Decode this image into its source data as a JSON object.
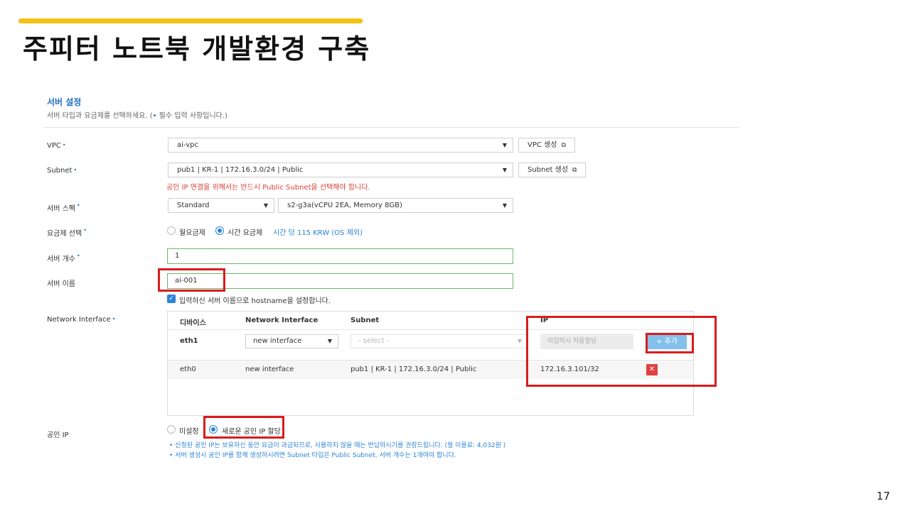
{
  "slide": {
    "title": "주피터 노트북 개발환경 구축",
    "page_number": "17",
    "accent_color": "#f6c112"
  },
  "section": {
    "title": "서버 설정",
    "desc_before": "서버 타입과 요금제를 선택하세요. (",
    "desc_marker": "•",
    "desc_after": " 필수 입력 사항입니다.)"
  },
  "required_marker": "•",
  "vpc": {
    "label": "VPC",
    "value": "ai-vpc",
    "create_button": "VPC 생성"
  },
  "subnet": {
    "label": "Subnet",
    "value": "pub1 | KR-1 | 172.16.3.0/24 | Public",
    "create_button": "Subnet 생성",
    "warning": "공인 IP 연결을 위해서는 반드시 Public Subnet을 선택해야 합니다."
  },
  "server_spec": {
    "label": "서버 스펙",
    "type": "Standard",
    "spec": "s2-g3a(vCPU 2EA, Memory 8GB)"
  },
  "pricing": {
    "label": "요금제 선택",
    "monthly": "월요금제",
    "hourly": "시간 요금제",
    "selected": "hourly",
    "price_text": "시간 당 115 KRW (OS 제외)"
  },
  "server_count": {
    "label": "서버 개수",
    "value": "1"
  },
  "server_name": {
    "label": "서버 이름",
    "value": "ai-001",
    "hostname_checkbox": "입력하신 서버 이름으로 hostname을 설정합니다.",
    "hostname_checked": true
  },
  "network_interface": {
    "label": "Network Interface",
    "columns": [
      "디바이스",
      "Network Interface",
      "Subnet",
      "IP"
    ],
    "new_row": {
      "device": "eth1",
      "interface": "new interface",
      "subnet_placeholder": "- select -",
      "ip_placeholder": "미입력시 자동할당",
      "add_button": "+ 추가"
    },
    "rows": [
      {
        "device": "eth0",
        "interface": "new interface",
        "subnet": "pub1 | KR-1 | 172.16.3.0/24 | Public",
        "ip": "172.16.3.101/32",
        "delete": "✕"
      }
    ]
  },
  "public_ip": {
    "label": "공인 IP",
    "option_none": "미설정",
    "option_new": "새로운 공인 IP 할당",
    "selected": "new",
    "notes": [
      "신청된 공인 IP는 보유하신 동안 요금이 과금되므로, 사용하지 않을 때는 반납하시기를 권장드립니다. (월 이용료: 4,032원 )",
      "서버 생성시 공인 IP를 함께 생성하시려면 Subnet 타입은 Public Subnet, 서버 개수는 1개여야 합니다."
    ]
  },
  "colors": {
    "accent_blue": "#2b84d6",
    "warning_red": "#d9423a",
    "highlight_red": "#d91c1c",
    "input_green": "#67b86b"
  }
}
